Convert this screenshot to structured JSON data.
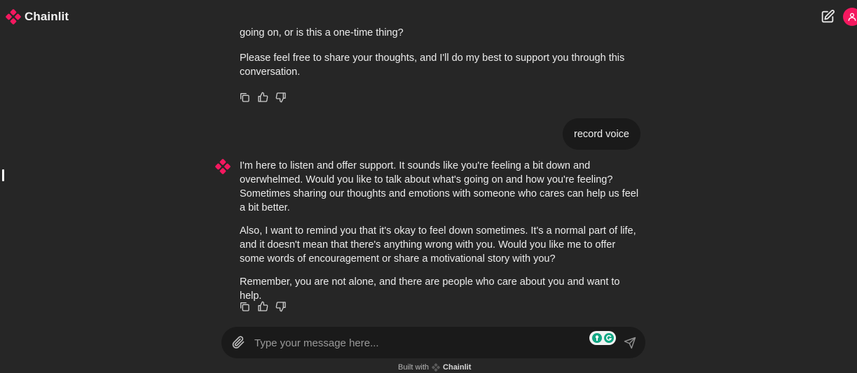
{
  "header": {
    "brand": "Chainlit",
    "new_chat_icon": "edit-icon",
    "avatar_icon": "user-icon",
    "accent": "#f4185f"
  },
  "messages": {
    "prev_partial": "going on, or is this a one-time thing?",
    "prev_para": "Please feel free to share your thoughts, and I'll do my best to support you through this conversation.",
    "user": "record voice",
    "bot": [
      "I'm here to listen and offer support. It sounds like you're feeling a bit down and overwhelmed. Would you like to talk about what's going on and how you're feeling? Sometimes sharing our thoughts and emotions with someone who cares can help us feel a bit better.",
      "Also, I want to remind you that it's okay to feel down sometimes. It's a normal part of life, and it doesn't mean that there's anything wrong with you. Would you like me to offer some words of encouragement or share a motivational story with you?",
      "Remember, you are not alone, and there are people who care about you and want to help."
    ]
  },
  "actions": {
    "icons": [
      "copy-icon",
      "thumbs-up-icon",
      "thumbs-down-icon"
    ]
  },
  "composer": {
    "placeholder": "Type your message here...",
    "attach_icon": "paperclip-icon",
    "send_icon": "send-icon"
  },
  "footer": {
    "built_with": "Built with",
    "brand": "Chainlit"
  }
}
